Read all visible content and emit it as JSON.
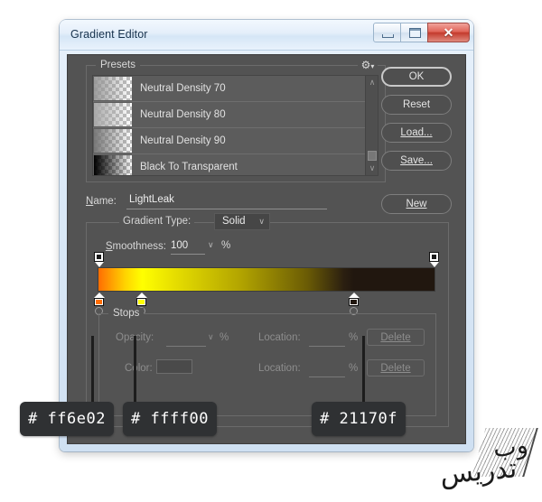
{
  "window": {
    "title": "Gradient Editor",
    "controls": {
      "minimize": "minimize-button",
      "restore": "restore-button",
      "close": "✕"
    }
  },
  "presets": {
    "legend": "Presets",
    "gear_icon": "⚙",
    "gear_caret": "▾",
    "scroll_up": "∧",
    "scroll_down": "∨",
    "items": [
      {
        "label": "Neutral Density 70",
        "thumb": "nd70"
      },
      {
        "label": "Neutral Density 80",
        "thumb": "nd80"
      },
      {
        "label": "Neutral Density 90",
        "thumb": "nd90"
      },
      {
        "label": "Black To Transparent",
        "thumb": "b2t"
      }
    ]
  },
  "buttons": {
    "ok": "OK",
    "reset": "Reset",
    "load": "Load...",
    "save": "Save...",
    "new": "New"
  },
  "name_row": {
    "label": "Name:",
    "value": "LightLeak"
  },
  "gradient": {
    "type_label": "Gradient Type:",
    "type_value": "Solid",
    "type_caret": "∨",
    "smoothness_label": "Smoothness:",
    "smoothness_value": "100",
    "smoothness_caret": "∨",
    "percent": "%",
    "bar_css": "linear-gradient(90deg, #ff6e02 0%, #ffd400 8%, #ffff00 13%, #e8e000 22%, #b3a500 42%, #6b5c05 62%, #2b1f10 73%, #21170f 76%, #21170f 100%)",
    "opacity_stops": [
      {
        "position_pct": 0,
        "name": "opacity-stop-left"
      },
      {
        "position_pct": 100,
        "name": "opacity-stop-right"
      }
    ],
    "color_stops": [
      {
        "position_pct": 0,
        "color": "#ff6e02",
        "hex_label": "# ff6e02"
      },
      {
        "position_pct": 13,
        "color": "#ffff00",
        "hex_label": "# ffff00"
      },
      {
        "position_pct": 76,
        "color": "#21170f",
        "hex_label": "# 21170f"
      }
    ]
  },
  "stops": {
    "legend": "Stops",
    "opacity_label": "Opacity:",
    "opacity_percent": "%",
    "opacity_location_label": "Location:",
    "opacity_location_percent": "%",
    "opacity_delete": "Delete",
    "color_label": "Color:",
    "color_location_label": "Location:",
    "color_location_percent": "%",
    "color_delete": "Delete"
  },
  "watermark": {
    "line1": "وب",
    "line2": "تدریس"
  }
}
